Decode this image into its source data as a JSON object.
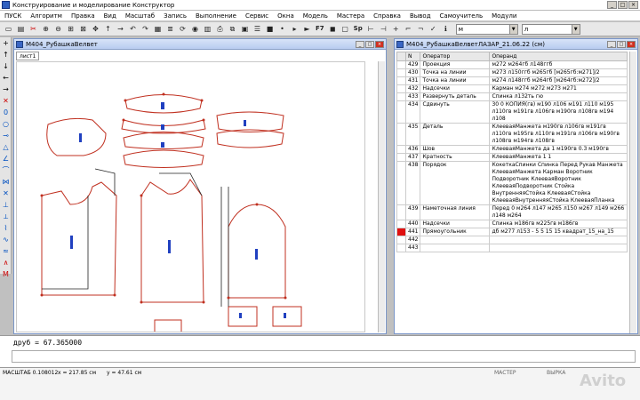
{
  "app": {
    "title": "Конструирование и моделирование  Конструктор"
  },
  "menu": [
    "ПУСК",
    "Алгоритм",
    "Правка",
    "Вид",
    "Масштаб",
    "Запись",
    "Выполнение",
    "Сервис",
    "Окна",
    "Модель",
    "Мастера",
    "Справка",
    "Вывод",
    "Самоучитель",
    "Модули"
  ],
  "toolbar": {
    "f7": "F7",
    "sp": "Sp",
    "select1": "м",
    "select2": "л"
  },
  "left_window": {
    "title": "М404_РубашкаВелвет",
    "tab": "лист1"
  },
  "right_window": {
    "title": "М404_РубашкаВелветЛАЗАР_21.06.22 (см)",
    "columns": [
      "N",
      "Оператор",
      "Операнд"
    ],
    "rows": [
      {
        "n": "429",
        "op": "Проекция",
        "arg": "м272 м264гб л148ггб"
      },
      {
        "n": "430",
        "op": "Точка на линии",
        "arg": "м273 л150ггб м265гб [м265гб:м271]/2"
      },
      {
        "n": "431",
        "op": "Точка на линии",
        "arg": "м274 л148ггб м264гб [м264гб:м272]/2"
      },
      {
        "n": "432",
        "op": "Надсечки",
        "arg": "Карман м274 м272 м273 м271"
      },
      {
        "n": "433",
        "op": "Развернуть деталь",
        "arg": "Спинка л132ть гю"
      },
      {
        "n": "434",
        "op": "Сдвинуть",
        "arg": "30 0 КОПИЯ(гв) м190 л106 м191 л110 м195 л110гв м191гв л106гв м190гв л108гв м194 л108"
      },
      {
        "n": "435",
        "op": "Деталь",
        "arg": "КлееваяМанжета м190гв л106гв м191гв л110гв м195гв л110гв м191гв л106гв м190гв л108гв м194гв л108гв"
      },
      {
        "n": "436",
        "op": "Шов",
        "arg": "КлееваяМанжета да 1 м190гв 0.3 м190гв"
      },
      {
        "n": "437",
        "op": "Кратность",
        "arg": "КлееваяМанжета 1 1"
      },
      {
        "n": "438",
        "op": "Порядок",
        "arg": "КокеткаСпинки Спинка Перед Рукав Манжета КлееваяМанжета Карман Воротник Подворотник КлееваяВоротник КлееваяПодворотник Стойка ВнутренняяСтойка КлееваяСтойка КлееваяВнутренняяСтойка КлееваяПланка"
      },
      {
        "n": "439",
        "op": "Наметочная линия",
        "arg": "Перед 0 м264 л147 м265 л150 м267 л149 м266 л148 м264"
      },
      {
        "n": "440",
        "op": "Надсечки",
        "arg": "Спинка м186гв м225гв м186гв"
      },
      {
        "n": "441",
        "op": "Прямоугольник",
        "arg": "дб м277 л153 - 5 5 15 15 квадрат_15_на_15"
      },
      {
        "n": "442",
        "op": "",
        "arg": ""
      },
      {
        "n": "443",
        "op": "",
        "arg": ""
      }
    ]
  },
  "command": {
    "text": "друб = 67.365000"
  },
  "status": {
    "scale": "МАСШТАБ 0.108012",
    "x": "x = 217.85 см",
    "y": "y = 47.61 см",
    "mode": "МАСТЕР",
    "flag": "ВЫРКА"
  },
  "colors": {
    "pattern": "#c03020",
    "accent": "#2040c0",
    "highlight": "#e01010"
  },
  "watermark": "Avito"
}
